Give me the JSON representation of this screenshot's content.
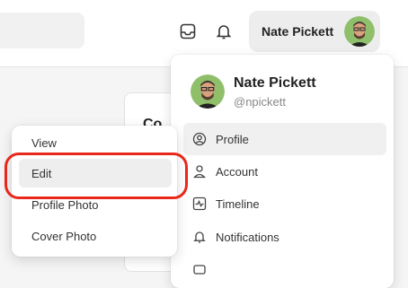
{
  "header": {
    "user_name": "Nate Pickett",
    "icons": [
      "inbox-icon",
      "bell-icon"
    ]
  },
  "background": {
    "card_title": "Co"
  },
  "user_menu": {
    "full_name": "Nate Pickett",
    "handle": "@npickett",
    "items": [
      {
        "label": "Profile",
        "icon": "user-circle-icon",
        "active": true
      },
      {
        "label": "Account",
        "icon": "user-icon"
      },
      {
        "label": "Timeline",
        "icon": "activity-icon"
      },
      {
        "label": "Notifications",
        "icon": "bell-icon"
      }
    ]
  },
  "photo_menu": {
    "items": [
      {
        "label": "View"
      },
      {
        "label": "Edit",
        "highlighted": true
      },
      {
        "label": "Profile Photo"
      },
      {
        "label": "Cover Photo"
      }
    ]
  },
  "colors": {
    "highlight_ring": "#e8281a"
  }
}
